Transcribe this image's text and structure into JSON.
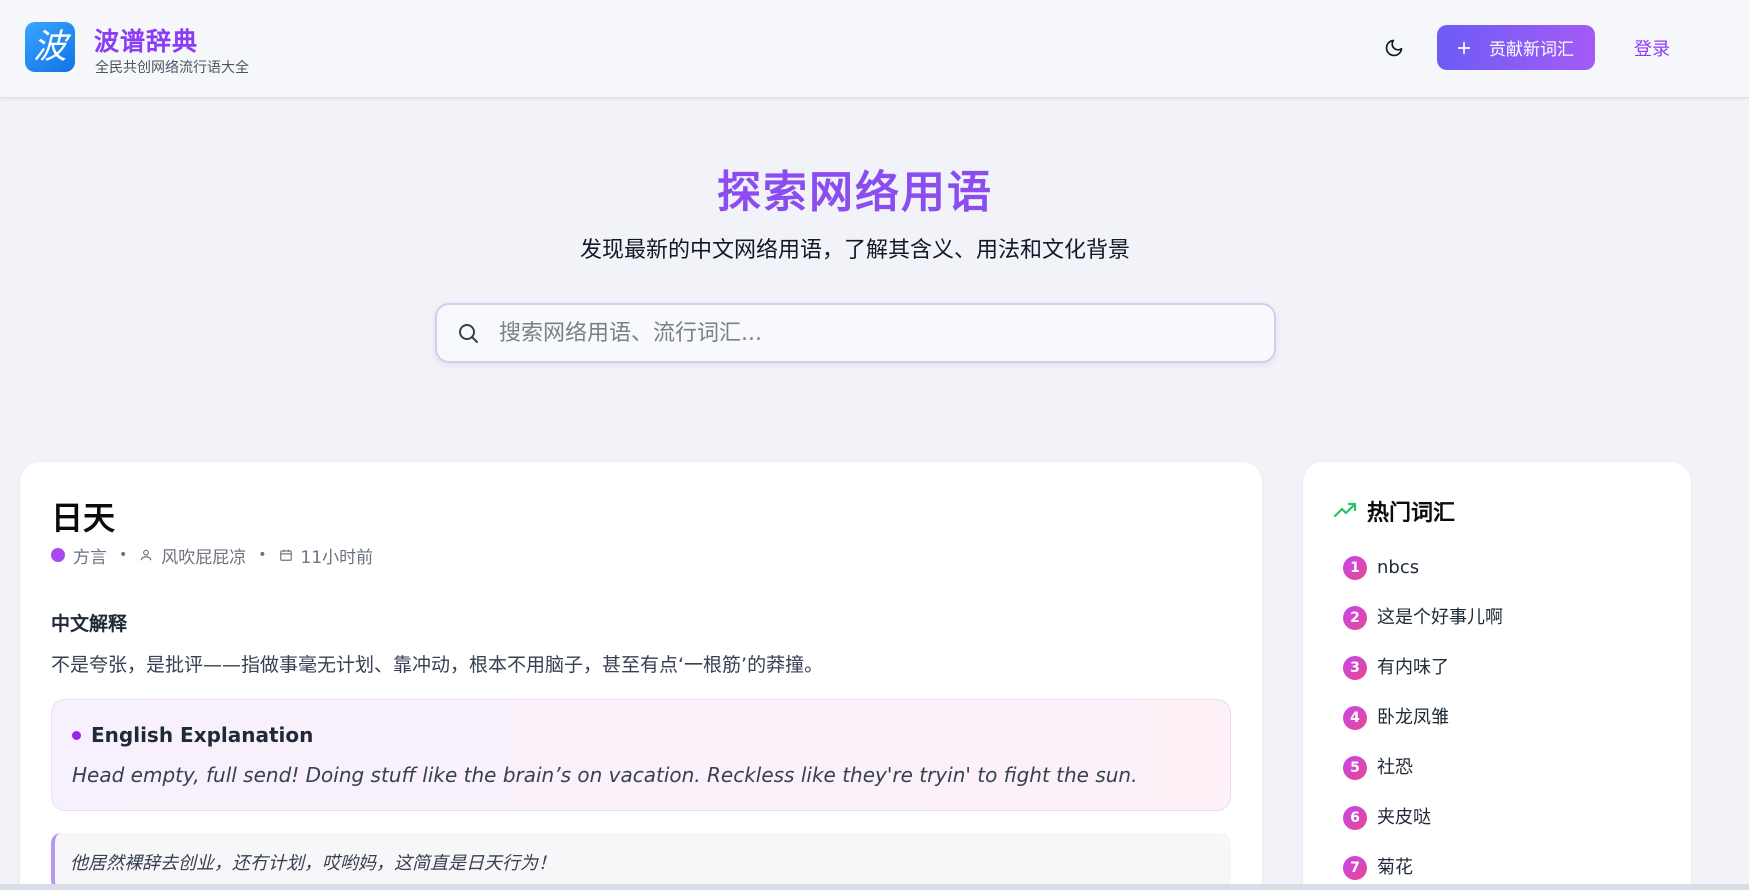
{
  "header": {
    "logo_glyph": "波",
    "brand_title": "波谱辞典",
    "brand_subtitle": "全民共创网络流行语大全",
    "contribute_label": "贡献新词汇",
    "login_label": "登录"
  },
  "hero": {
    "title": "探索网络用语",
    "subtitle": "发现最新的中文网络用语，了解其含义、用法和文化背景",
    "search_placeholder": "搜索网络用语、流行词汇..."
  },
  "word": {
    "title": "日天",
    "category": "方言",
    "author": "风吹屁屁凉",
    "time": "11小时前",
    "cn_label": "中文解释",
    "cn_text": "不是夸张，是批评——指做事毫无计划、靠冲动，根本不用脑子，甚至有点‘一根筋’的莽撞。",
    "en_label": "English Explanation",
    "en_text": "Head empty, full send! Doing stuff like the brain’s on vacation. Reckless like they're tryin' to fight the sun.",
    "example": "他居然裸辞去创业，还冇计划，哎哟妈，这简直是日天行为！"
  },
  "trending": {
    "title": "热门词汇",
    "items": [
      {
        "rank": "1",
        "label": "nbcs"
      },
      {
        "rank": "2",
        "label": "这是个好事儿啊"
      },
      {
        "rank": "3",
        "label": "有内味了"
      },
      {
        "rank": "4",
        "label": "卧龙凤雏"
      },
      {
        "rank": "5",
        "label": "社恐"
      },
      {
        "rank": "6",
        "label": "夹皮哒"
      },
      {
        "rank": "7",
        "label": "菊花"
      }
    ]
  },
  "colors": {
    "brand": "#8b3cf7",
    "category_dot": "#a64bf0",
    "trend_icon": "#22c55e"
  }
}
